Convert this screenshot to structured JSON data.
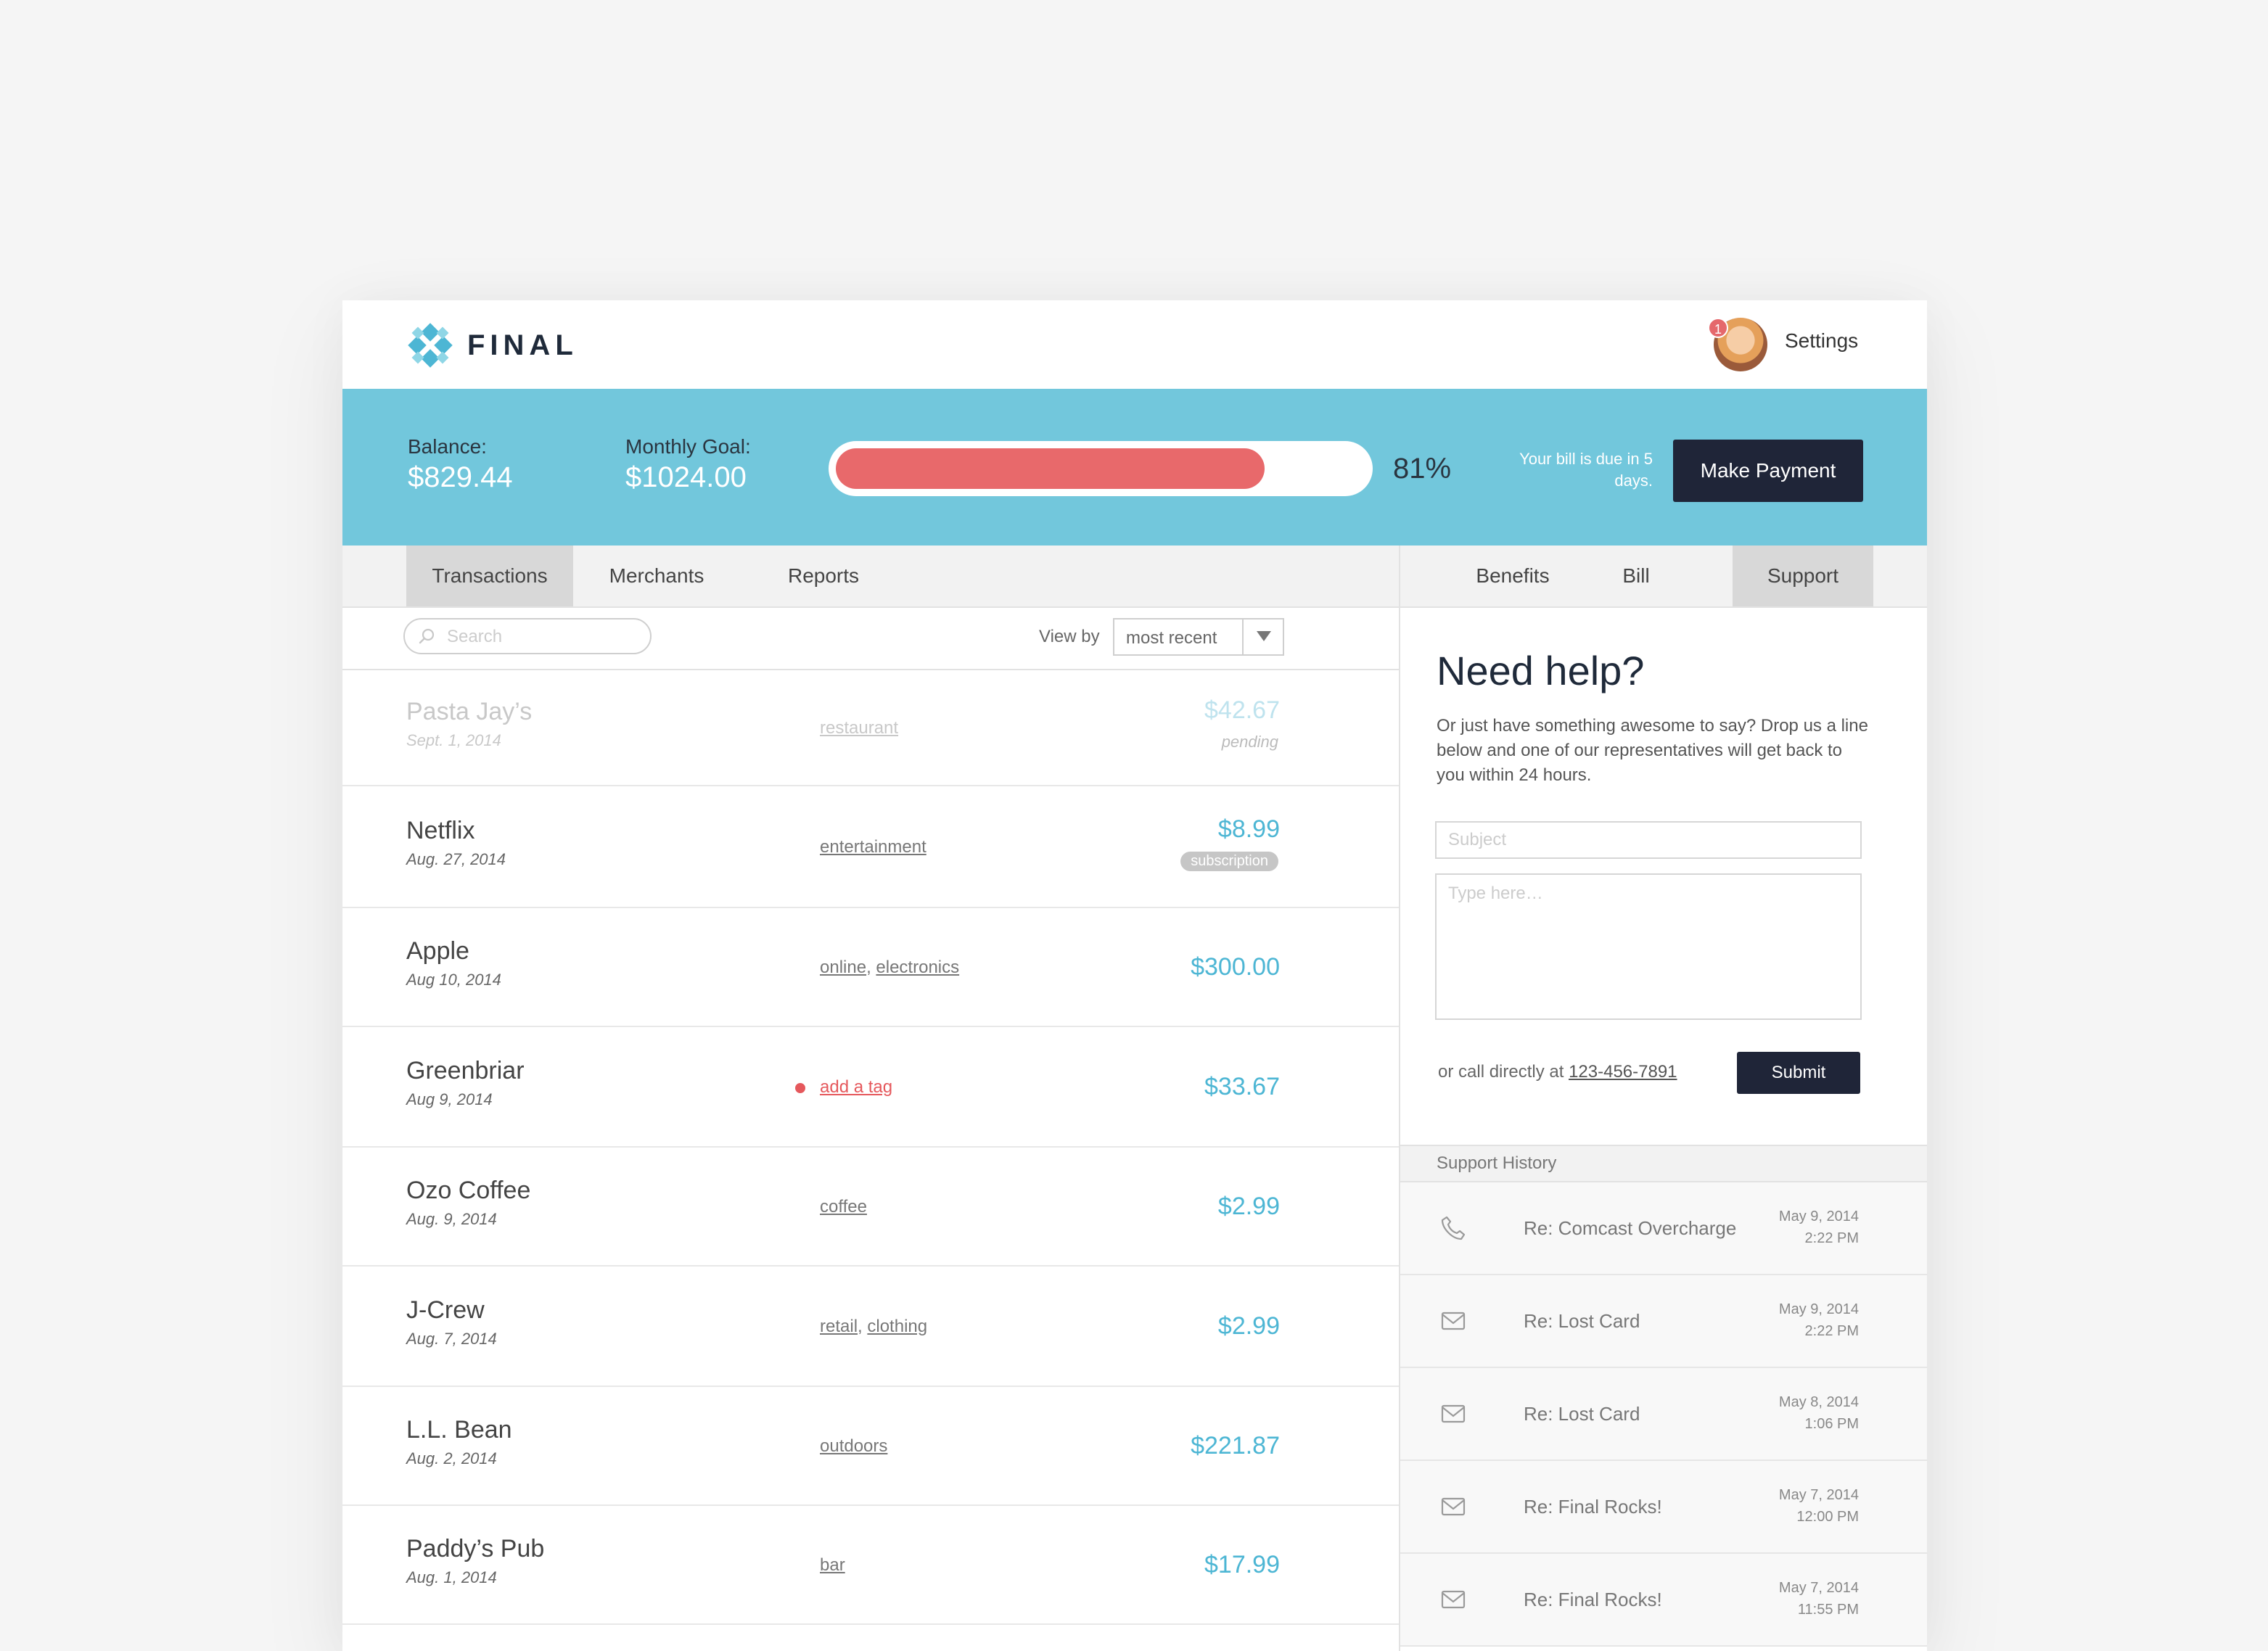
{
  "brand": {
    "name": "FINAL",
    "accent": "#72c7dc",
    "logo_color": "#4db6d4"
  },
  "header": {
    "settings_label": "Settings",
    "notification_count": "1"
  },
  "summary": {
    "balance_label": "Balance:",
    "balance_value": "$829.44",
    "goal_label": "Monthly Goal:",
    "goal_value": "$1024.00",
    "progress_fraction": 0.81,
    "progress_percent": "81%",
    "due_note": "Your bill is due in 5 days.",
    "pay_button": "Make Payment",
    "progress_color": "#e8696b"
  },
  "left_tabs": [
    {
      "label": "Transactions",
      "active": true
    },
    {
      "label": "Merchants",
      "active": false
    },
    {
      "label": "Reports",
      "active": false
    }
  ],
  "right_tabs": [
    {
      "label": "Benefits",
      "active": false
    },
    {
      "label": "Bill",
      "active": false
    },
    {
      "label": "Support",
      "active": true
    }
  ],
  "toolbar": {
    "search_placeholder": "Search",
    "view_by_label": "View by",
    "view_by_value": "most recent"
  },
  "transactions": [
    {
      "name": "Pasta Jay’s",
      "date": "Sept. 1, 2014",
      "tags": [
        "restaurant"
      ],
      "amount": "$42.67",
      "note": "pending",
      "note_style": "pending",
      "faded": true
    },
    {
      "name": "Netflix",
      "date": "Aug. 27, 2014",
      "tags": [
        "entertainment"
      ],
      "amount": "$8.99",
      "note": "subscription",
      "note_style": "pill",
      "faded": false
    },
    {
      "name": "Apple",
      "date": "Aug 10, 2014",
      "tags": [
        "online",
        "electronics"
      ],
      "amount": "$300.00",
      "note": "",
      "note_style": "",
      "faded": false
    },
    {
      "name": "Greenbriar",
      "date": "Aug 9, 2014",
      "tags": [],
      "add_tag": "add a tag",
      "amount": "$33.67",
      "note": "",
      "note_style": "",
      "faded": false
    },
    {
      "name": "Ozo Coffee",
      "date": "Aug. 9, 2014",
      "tags": [
        "coffee"
      ],
      "amount": "$2.99",
      "note": "",
      "note_style": "",
      "faded": false
    },
    {
      "name": "J-Crew",
      "date": "Aug. 7, 2014",
      "tags": [
        "retail",
        "clothing"
      ],
      "amount": "$2.99",
      "note": "",
      "note_style": "",
      "faded": false
    },
    {
      "name": "L.L. Bean",
      "date": "Aug. 2, 2014",
      "tags": [
        "outdoors"
      ],
      "amount": "$221.87",
      "note": "",
      "note_style": "",
      "faded": false
    },
    {
      "name": "Paddy’s Pub",
      "date": "Aug. 1, 2014",
      "tags": [
        "bar"
      ],
      "amount": "$17.99",
      "note": "",
      "note_style": "",
      "faded": false
    }
  ],
  "support": {
    "title": "Need help?",
    "body": "Or just have something awesome to say? Drop us a line below and one of our representatives will get back to you within 24 hours.",
    "subject_placeholder": "Subject",
    "message_placeholder": "Type here…",
    "call_prefix": "or call directly at ",
    "phone": "123-456-7891",
    "submit_label": "Submit",
    "history_title": "Support History",
    "history": [
      {
        "icon": "phone-icon",
        "subject": "Re: Comcast Overcharge",
        "date": "May 9, 2014",
        "time": "2:22 PM"
      },
      {
        "icon": "mail-icon",
        "subject": "Re: Lost Card",
        "date": "May 9, 2014",
        "time": "2:22 PM"
      },
      {
        "icon": "mail-icon",
        "subject": "Re: Lost Card",
        "date": "May 8, 2014",
        "time": "1:06 PM"
      },
      {
        "icon": "mail-icon",
        "subject": "Re: Final Rocks!",
        "date": "May 7, 2014",
        "time": "12:00 PM"
      },
      {
        "icon": "mail-icon",
        "subject": "Re: Final Rocks!",
        "date": "May 7, 2014",
        "time": "11:55 PM"
      }
    ]
  }
}
